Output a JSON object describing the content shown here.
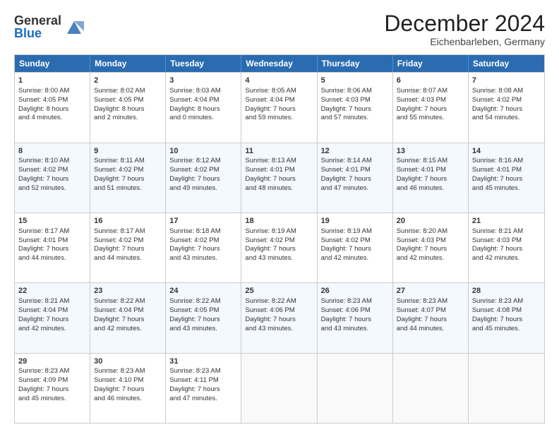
{
  "logo": {
    "line1": "General",
    "line2": "Blue"
  },
  "title": "December 2024",
  "subtitle": "Eichenbarleben, Germany",
  "days": [
    "Sunday",
    "Monday",
    "Tuesday",
    "Wednesday",
    "Thursday",
    "Friday",
    "Saturday"
  ],
  "rows": [
    [
      {
        "day": "1",
        "lines": [
          "Sunrise: 8:00 AM",
          "Sunset: 4:05 PM",
          "Daylight: 8 hours",
          "and 4 minutes."
        ]
      },
      {
        "day": "2",
        "lines": [
          "Sunrise: 8:02 AM",
          "Sunset: 4:05 PM",
          "Daylight: 8 hours",
          "and 2 minutes."
        ]
      },
      {
        "day": "3",
        "lines": [
          "Sunrise: 8:03 AM",
          "Sunset: 4:04 PM",
          "Daylight: 8 hours",
          "and 0 minutes."
        ]
      },
      {
        "day": "4",
        "lines": [
          "Sunrise: 8:05 AM",
          "Sunset: 4:04 PM",
          "Daylight: 7 hours",
          "and 59 minutes."
        ]
      },
      {
        "day": "5",
        "lines": [
          "Sunrise: 8:06 AM",
          "Sunset: 4:03 PM",
          "Daylight: 7 hours",
          "and 57 minutes."
        ]
      },
      {
        "day": "6",
        "lines": [
          "Sunrise: 8:07 AM",
          "Sunset: 4:03 PM",
          "Daylight: 7 hours",
          "and 55 minutes."
        ]
      },
      {
        "day": "7",
        "lines": [
          "Sunrise: 8:08 AM",
          "Sunset: 4:02 PM",
          "Daylight: 7 hours",
          "and 54 minutes."
        ]
      }
    ],
    [
      {
        "day": "8",
        "lines": [
          "Sunrise: 8:10 AM",
          "Sunset: 4:02 PM",
          "Daylight: 7 hours",
          "and 52 minutes."
        ]
      },
      {
        "day": "9",
        "lines": [
          "Sunrise: 8:11 AM",
          "Sunset: 4:02 PM",
          "Daylight: 7 hours",
          "and 51 minutes."
        ]
      },
      {
        "day": "10",
        "lines": [
          "Sunrise: 8:12 AM",
          "Sunset: 4:02 PM",
          "Daylight: 7 hours",
          "and 49 minutes."
        ]
      },
      {
        "day": "11",
        "lines": [
          "Sunrise: 8:13 AM",
          "Sunset: 4:01 PM",
          "Daylight: 7 hours",
          "and 48 minutes."
        ]
      },
      {
        "day": "12",
        "lines": [
          "Sunrise: 8:14 AM",
          "Sunset: 4:01 PM",
          "Daylight: 7 hours",
          "and 47 minutes."
        ]
      },
      {
        "day": "13",
        "lines": [
          "Sunrise: 8:15 AM",
          "Sunset: 4:01 PM",
          "Daylight: 7 hours",
          "and 46 minutes."
        ]
      },
      {
        "day": "14",
        "lines": [
          "Sunrise: 8:16 AM",
          "Sunset: 4:01 PM",
          "Daylight: 7 hours",
          "and 45 minutes."
        ]
      }
    ],
    [
      {
        "day": "15",
        "lines": [
          "Sunrise: 8:17 AM",
          "Sunset: 4:01 PM",
          "Daylight: 7 hours",
          "and 44 minutes."
        ]
      },
      {
        "day": "16",
        "lines": [
          "Sunrise: 8:17 AM",
          "Sunset: 4:02 PM",
          "Daylight: 7 hours",
          "and 44 minutes."
        ]
      },
      {
        "day": "17",
        "lines": [
          "Sunrise: 8:18 AM",
          "Sunset: 4:02 PM",
          "Daylight: 7 hours",
          "and 43 minutes."
        ]
      },
      {
        "day": "18",
        "lines": [
          "Sunrise: 8:19 AM",
          "Sunset: 4:02 PM",
          "Daylight: 7 hours",
          "and 43 minutes."
        ]
      },
      {
        "day": "19",
        "lines": [
          "Sunrise: 8:19 AM",
          "Sunset: 4:02 PM",
          "Daylight: 7 hours",
          "and 42 minutes."
        ]
      },
      {
        "day": "20",
        "lines": [
          "Sunrise: 8:20 AM",
          "Sunset: 4:03 PM",
          "Daylight: 7 hours",
          "and 42 minutes."
        ]
      },
      {
        "day": "21",
        "lines": [
          "Sunrise: 8:21 AM",
          "Sunset: 4:03 PM",
          "Daylight: 7 hours",
          "and 42 minutes."
        ]
      }
    ],
    [
      {
        "day": "22",
        "lines": [
          "Sunrise: 8:21 AM",
          "Sunset: 4:04 PM",
          "Daylight: 7 hours",
          "and 42 minutes."
        ]
      },
      {
        "day": "23",
        "lines": [
          "Sunrise: 8:22 AM",
          "Sunset: 4:04 PM",
          "Daylight: 7 hours",
          "and 42 minutes."
        ]
      },
      {
        "day": "24",
        "lines": [
          "Sunrise: 8:22 AM",
          "Sunset: 4:05 PM",
          "Daylight: 7 hours",
          "and 43 minutes."
        ]
      },
      {
        "day": "25",
        "lines": [
          "Sunrise: 8:22 AM",
          "Sunset: 4:06 PM",
          "Daylight: 7 hours",
          "and 43 minutes."
        ]
      },
      {
        "day": "26",
        "lines": [
          "Sunrise: 8:23 AM",
          "Sunset: 4:06 PM",
          "Daylight: 7 hours",
          "and 43 minutes."
        ]
      },
      {
        "day": "27",
        "lines": [
          "Sunrise: 8:23 AM",
          "Sunset: 4:07 PM",
          "Daylight: 7 hours",
          "and 44 minutes."
        ]
      },
      {
        "day": "28",
        "lines": [
          "Sunrise: 8:23 AM",
          "Sunset: 4:08 PM",
          "Daylight: 7 hours",
          "and 45 minutes."
        ]
      }
    ],
    [
      {
        "day": "29",
        "lines": [
          "Sunrise: 8:23 AM",
          "Sunset: 4:09 PM",
          "Daylight: 7 hours",
          "and 45 minutes."
        ]
      },
      {
        "day": "30",
        "lines": [
          "Sunrise: 8:23 AM",
          "Sunset: 4:10 PM",
          "Daylight: 7 hours",
          "and 46 minutes."
        ]
      },
      {
        "day": "31",
        "lines": [
          "Sunrise: 8:23 AM",
          "Sunset: 4:11 PM",
          "Daylight: 7 hours",
          "and 47 minutes."
        ]
      },
      {
        "day": "",
        "lines": []
      },
      {
        "day": "",
        "lines": []
      },
      {
        "day": "",
        "lines": []
      },
      {
        "day": "",
        "lines": []
      }
    ]
  ]
}
